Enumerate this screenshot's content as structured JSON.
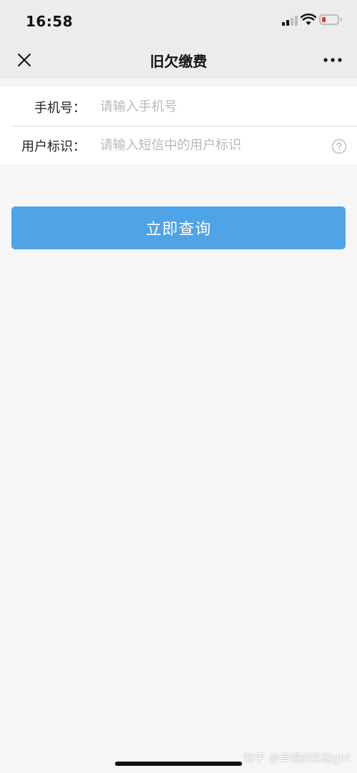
{
  "status_bar": {
    "time": "16:58",
    "signal_icon": "cellular-signal-icon",
    "wifi_icon": "wifi-icon",
    "battery_icon": "battery-low-icon",
    "battery_level_color": "#e53935"
  },
  "nav": {
    "title": "旧欠缴费",
    "close_icon": "close-icon",
    "more_icon": "more-dots-icon"
  },
  "form": {
    "phone": {
      "label": "手机号：",
      "value": "",
      "placeholder": "请输入手机号"
    },
    "user_id": {
      "label": "用户标识：",
      "value": "",
      "placeholder": "请输入短信中的用户标识",
      "help_icon": "question-circle-icon"
    }
  },
  "query_button": {
    "label": "立即查询",
    "color": "#4fa3e7"
  },
  "watermark": "知乎 @幸福的实验girl"
}
